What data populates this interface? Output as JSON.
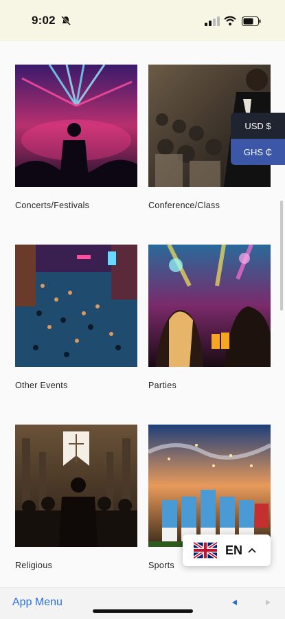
{
  "status_bar": {
    "time": "9:02"
  },
  "categories": [
    {
      "label": "Concerts/Festivals"
    },
    {
      "label": "Conference/Class"
    },
    {
      "label": "Other Events"
    },
    {
      "label": "Parties"
    },
    {
      "label": "Religious"
    },
    {
      "label": "Sports"
    }
  ],
  "currency": {
    "usd": "USD $",
    "ghs": "GHS ₵"
  },
  "language": {
    "code": "EN"
  },
  "bottom_bar": {
    "menu_label": "App Menu"
  },
  "colors": {
    "accent": "#3c57a8",
    "link": "#2a6fd6",
    "dark": "#1f2430"
  }
}
